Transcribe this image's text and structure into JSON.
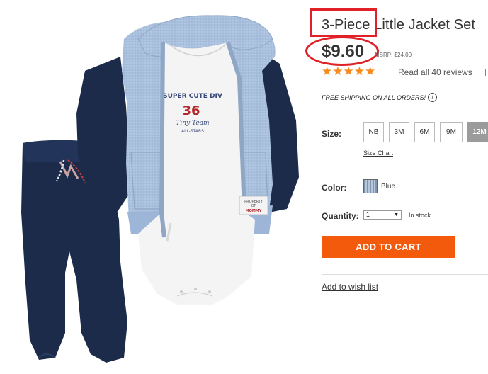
{
  "product": {
    "title": "3-Piece Little Jacket Set",
    "price": "$9.60",
    "msrp": "MSRP: $24.00",
    "rating": 5,
    "reviews_text": "Read all 40 reviews",
    "shipping_text": "FREE SHIPPING ON ALL ORDERS!",
    "info_glyph": "i"
  },
  "image": {
    "onesie_text_1": "SUPER CUTE DIV",
    "onesie_number": "36",
    "onesie_text_2": "Tiny Team",
    "onesie_text_3": "ALL-STARS",
    "tag_line_1": "PROPERTY",
    "tag_line_2": "OF",
    "tag_line_3": "MOMMY"
  },
  "size": {
    "label": "Size:",
    "options": [
      "NB",
      "3M",
      "6M",
      "9M",
      "12M"
    ],
    "selected": "12M",
    "chart_link": "Size Chart"
  },
  "color": {
    "label": "Color:",
    "value": "Blue"
  },
  "quantity": {
    "label": "Quantity:",
    "value": "1",
    "stock": "In stock"
  },
  "actions": {
    "add_to_cart": "ADD TO CART",
    "wishlist": "Add to wish list"
  },
  "colors": {
    "accent_orange": "#f35a0c",
    "star": "#f58a1f",
    "highlight_red": "#e02127",
    "jacket_blue": "#a9c0dc",
    "navy": "#1b2a47"
  }
}
